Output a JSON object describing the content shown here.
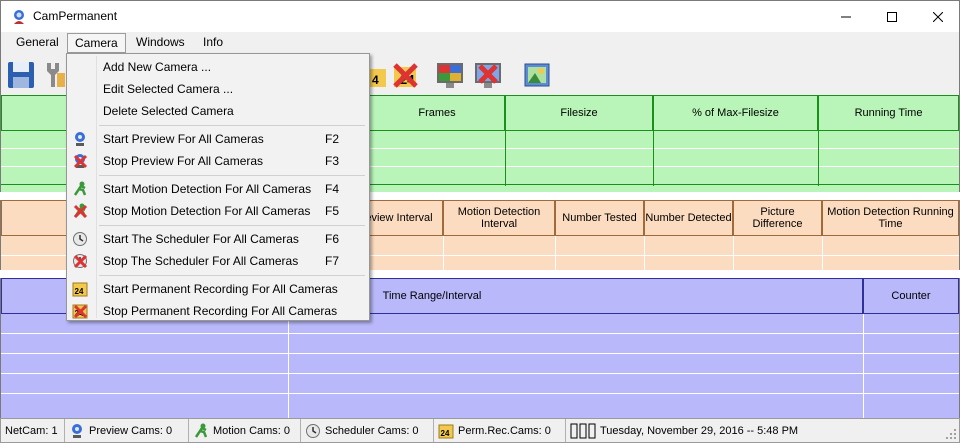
{
  "window": {
    "title": "CamPermanent"
  },
  "menubar": [
    "General",
    "Camera",
    "Windows",
    "Info"
  ],
  "camera_menu": {
    "items": [
      {
        "label": "Add New Camera ...",
        "shortcut": "",
        "icon": ""
      },
      {
        "label": "Edit Selected Camera ...",
        "shortcut": "",
        "icon": ""
      },
      {
        "label": "Delete Selected Camera",
        "shortcut": "",
        "icon": ""
      },
      {
        "label": "Start Preview For All Cameras",
        "shortcut": "F2",
        "icon": "preview-start-icon"
      },
      {
        "label": "Stop Preview For All Cameras",
        "shortcut": "F3",
        "icon": "preview-stop-icon"
      },
      {
        "label": "Start Motion Detection For All Cameras",
        "shortcut": "F4",
        "icon": "motion-start-icon"
      },
      {
        "label": "Stop Motion Detection For All Cameras",
        "shortcut": "F5",
        "icon": "motion-stop-icon"
      },
      {
        "label": "Start The Scheduler For All Cameras",
        "shortcut": "F6",
        "icon": "scheduler-start-icon"
      },
      {
        "label": "Stop The Scheduler For All Cameras",
        "shortcut": "F7",
        "icon": "scheduler-stop-icon"
      },
      {
        "label": "Start Permanent Recording For All Cameras",
        "shortcut": "",
        "icon": "recording-start-icon"
      },
      {
        "label": "Stop Permanent Recording For All Cameras",
        "shortcut": "",
        "icon": "recording-stop-icon"
      }
    ]
  },
  "recording_grid": {
    "columns": [
      "Frames",
      "Filesize",
      "% of Max-Filesize",
      "Running Time"
    ]
  },
  "motion_grid": {
    "columns": [
      "Preview Interval",
      "Motion Detection Interval",
      "Number Tested",
      "Number Detected",
      "Picture Difference",
      "Motion Detection Running Time"
    ]
  },
  "scheduler_grid": {
    "columns": [
      "Time Range/Interval",
      "Counter"
    ]
  },
  "statusbar": {
    "netcam": "NetCam: 1",
    "preview": "Preview Cams: 0",
    "motion": "Motion Cams: 0",
    "scheduler": "Scheduler Cams: 0",
    "permrec": "Perm.Rec.Cams: 0",
    "datetime": "Tuesday, November 29, 2016 -- 5:48 PM"
  },
  "colors": {
    "green_grid": "#b9f5b9",
    "orange_grid": "#fcdcc0",
    "purple_grid": "#b8b8fa"
  }
}
